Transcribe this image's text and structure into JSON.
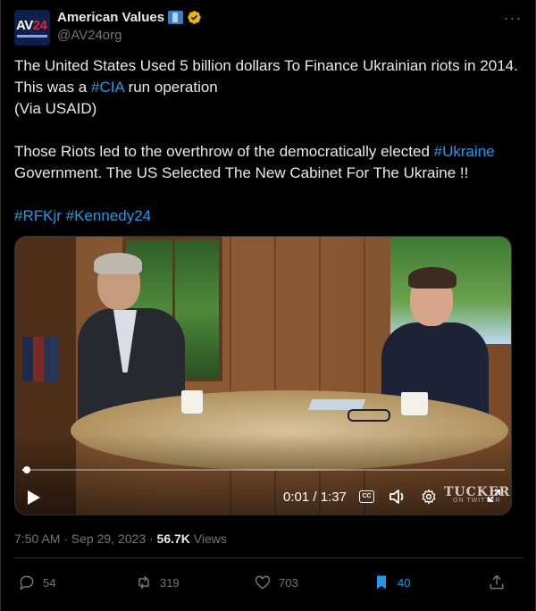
{
  "account": {
    "avatar_text": "AV24",
    "name": "American Values",
    "handle": "@AV24org"
  },
  "tweet": {
    "line1_pre": "The United States Used 5 billion dollars To Finance Ukrainian riots in 2014. This was a ",
    "line1_tag": "#CIA",
    "line1_post": " run operation",
    "line2": "(Via USAID)",
    "line3_pre": "Those Riots led to the overthrow of the democratically elected ",
    "line3_tag": "#Ukraine",
    "line3_post": " Government. The US Selected The New Cabinet For The Ukraine !!",
    "tag1": "#RFKjr",
    "tag2": "#Kennedy24"
  },
  "video": {
    "time_display": "0:01 / 1:37",
    "progress_fraction": 0.01,
    "cc_label": "CC",
    "watermark": "TUCKER",
    "watermark_sub": "ON TWITTER"
  },
  "meta": {
    "time": "7:50 AM · Sep 29, 2023 · ",
    "views_count": "56.7K",
    "views_label": " Views"
  },
  "actions": {
    "replies": "54",
    "reposts": "319",
    "likes": "703",
    "bookmarks": "40"
  },
  "colors": {
    "accent": "#1d9bf0",
    "muted": "#71767b",
    "verified": "#e2b719"
  },
  "icons": [
    "flag-icon",
    "verified-icon",
    "more-icon",
    "play-icon",
    "cc-icon",
    "volume-icon",
    "gear-icon",
    "fullscreen-icon",
    "reply-icon",
    "repost-icon",
    "like-icon",
    "bookmark-icon",
    "share-icon"
  ]
}
